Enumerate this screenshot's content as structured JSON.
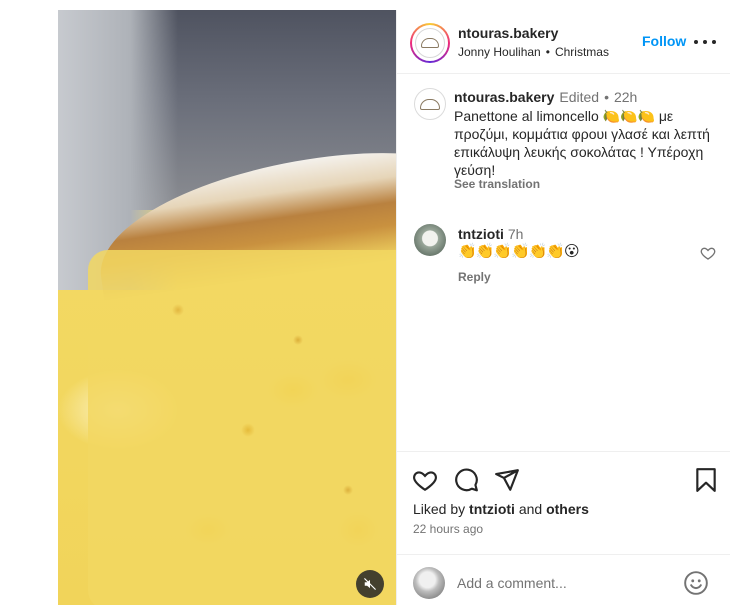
{
  "post": {
    "author": "ntouras.bakery",
    "subline_user": "Jonny Houlihan",
    "subline_dot": "•",
    "subline_tag": "Christmas",
    "follow_label": "Follow"
  },
  "caption": {
    "name": "ntouras.bakery",
    "edited": "Edited",
    "sep": "•",
    "age": "22h",
    "text": "Panettone al limoncello 🍋🍋🍋 με προζύμι, κομμάτια φρουι γλασέ και λεπτή επικάλυψη λευκής σοκολάτας ! Υπέροχη γεύση!",
    "see_translation": "See translation"
  },
  "comments": [
    {
      "name": "tntzioti",
      "age": "7h",
      "text": "👏👏👏👏👏👏😮",
      "reply_label": "Reply"
    }
  ],
  "likes": {
    "prefix": "Liked by",
    "user": "tntzioti",
    "conj": "and",
    "others": "others",
    "time": "22 hours ago"
  },
  "add_comment": {
    "placeholder": "Add a comment..."
  },
  "icons": {
    "more": "more-icon",
    "mute": "speaker-muted-icon",
    "like": "heart-icon",
    "comment": "comment-bubble-icon",
    "share": "paper-plane-icon",
    "save": "bookmark-icon",
    "emoji": "smiley-icon"
  },
  "colors": {
    "accent": "#0095f6",
    "text": "#262626",
    "muted": "#737373",
    "divider": "#efefef"
  }
}
